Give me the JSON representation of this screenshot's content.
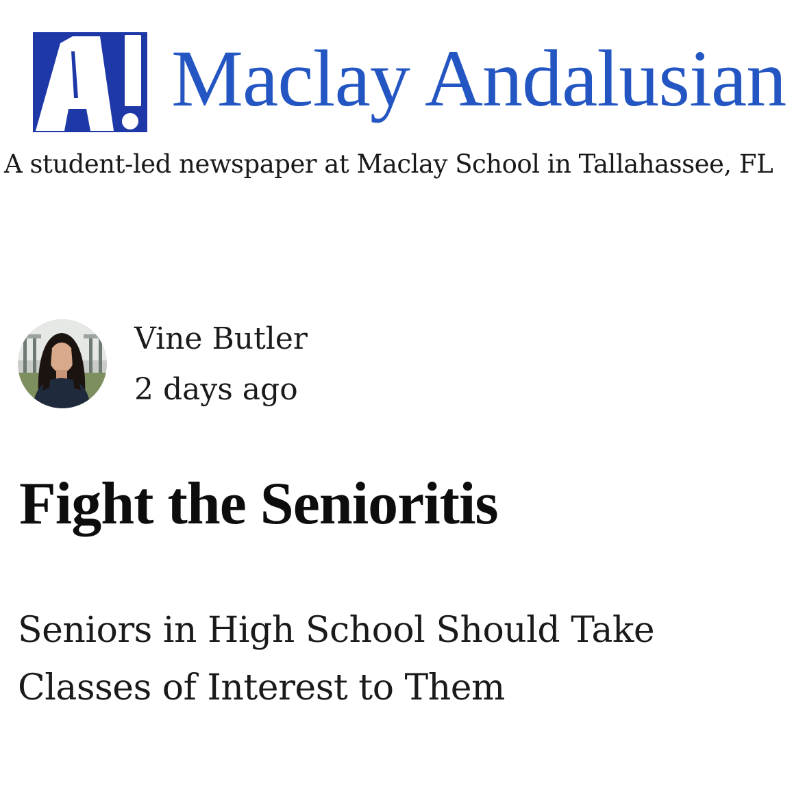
{
  "header": {
    "site_title": "Maclay Andalusian",
    "tagline": "A student-led newspaper at Maclay School in Tallahassee, FL",
    "logo_icon": "andalusian-a-logo-icon",
    "brand_color": "#2356c2",
    "logo_bg_color": "#1e38a8"
  },
  "article": {
    "author": {
      "name": "Vine Butler",
      "avatar_icon": "author-avatar",
      "posted": "2 days ago"
    },
    "title": "Fight the Senioritis",
    "subtitle": "Seniors in High School Should Take Classes of Interest to Them"
  }
}
